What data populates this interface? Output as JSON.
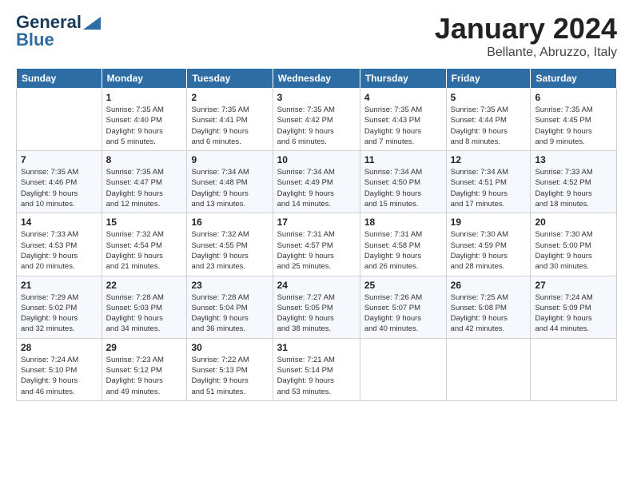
{
  "header": {
    "logo_general": "General",
    "logo_blue": "Blue",
    "month": "January 2024",
    "location": "Bellante, Abruzzo, Italy"
  },
  "weekdays": [
    "Sunday",
    "Monday",
    "Tuesday",
    "Wednesday",
    "Thursday",
    "Friday",
    "Saturday"
  ],
  "weeks": [
    [
      {
        "day": "",
        "info": ""
      },
      {
        "day": "1",
        "info": "Sunrise: 7:35 AM\nSunset: 4:40 PM\nDaylight: 9 hours\nand 5 minutes."
      },
      {
        "day": "2",
        "info": "Sunrise: 7:35 AM\nSunset: 4:41 PM\nDaylight: 9 hours\nand 6 minutes."
      },
      {
        "day": "3",
        "info": "Sunrise: 7:35 AM\nSunset: 4:42 PM\nDaylight: 9 hours\nand 6 minutes."
      },
      {
        "day": "4",
        "info": "Sunrise: 7:35 AM\nSunset: 4:43 PM\nDaylight: 9 hours\nand 7 minutes."
      },
      {
        "day": "5",
        "info": "Sunrise: 7:35 AM\nSunset: 4:44 PM\nDaylight: 9 hours\nand 8 minutes."
      },
      {
        "day": "6",
        "info": "Sunrise: 7:35 AM\nSunset: 4:45 PM\nDaylight: 9 hours\nand 9 minutes."
      }
    ],
    [
      {
        "day": "7",
        "info": "Sunrise: 7:35 AM\nSunset: 4:46 PM\nDaylight: 9 hours\nand 10 minutes."
      },
      {
        "day": "8",
        "info": "Sunrise: 7:35 AM\nSunset: 4:47 PM\nDaylight: 9 hours\nand 12 minutes."
      },
      {
        "day": "9",
        "info": "Sunrise: 7:34 AM\nSunset: 4:48 PM\nDaylight: 9 hours\nand 13 minutes."
      },
      {
        "day": "10",
        "info": "Sunrise: 7:34 AM\nSunset: 4:49 PM\nDaylight: 9 hours\nand 14 minutes."
      },
      {
        "day": "11",
        "info": "Sunrise: 7:34 AM\nSunset: 4:50 PM\nDaylight: 9 hours\nand 15 minutes."
      },
      {
        "day": "12",
        "info": "Sunrise: 7:34 AM\nSunset: 4:51 PM\nDaylight: 9 hours\nand 17 minutes."
      },
      {
        "day": "13",
        "info": "Sunrise: 7:33 AM\nSunset: 4:52 PM\nDaylight: 9 hours\nand 18 minutes."
      }
    ],
    [
      {
        "day": "14",
        "info": "Sunrise: 7:33 AM\nSunset: 4:53 PM\nDaylight: 9 hours\nand 20 minutes."
      },
      {
        "day": "15",
        "info": "Sunrise: 7:32 AM\nSunset: 4:54 PM\nDaylight: 9 hours\nand 21 minutes."
      },
      {
        "day": "16",
        "info": "Sunrise: 7:32 AM\nSunset: 4:55 PM\nDaylight: 9 hours\nand 23 minutes."
      },
      {
        "day": "17",
        "info": "Sunrise: 7:31 AM\nSunset: 4:57 PM\nDaylight: 9 hours\nand 25 minutes."
      },
      {
        "day": "18",
        "info": "Sunrise: 7:31 AM\nSunset: 4:58 PM\nDaylight: 9 hours\nand 26 minutes."
      },
      {
        "day": "19",
        "info": "Sunrise: 7:30 AM\nSunset: 4:59 PM\nDaylight: 9 hours\nand 28 minutes."
      },
      {
        "day": "20",
        "info": "Sunrise: 7:30 AM\nSunset: 5:00 PM\nDaylight: 9 hours\nand 30 minutes."
      }
    ],
    [
      {
        "day": "21",
        "info": "Sunrise: 7:29 AM\nSunset: 5:02 PM\nDaylight: 9 hours\nand 32 minutes."
      },
      {
        "day": "22",
        "info": "Sunrise: 7:28 AM\nSunset: 5:03 PM\nDaylight: 9 hours\nand 34 minutes."
      },
      {
        "day": "23",
        "info": "Sunrise: 7:28 AM\nSunset: 5:04 PM\nDaylight: 9 hours\nand 36 minutes."
      },
      {
        "day": "24",
        "info": "Sunrise: 7:27 AM\nSunset: 5:05 PM\nDaylight: 9 hours\nand 38 minutes."
      },
      {
        "day": "25",
        "info": "Sunrise: 7:26 AM\nSunset: 5:07 PM\nDaylight: 9 hours\nand 40 minutes."
      },
      {
        "day": "26",
        "info": "Sunrise: 7:25 AM\nSunset: 5:08 PM\nDaylight: 9 hours\nand 42 minutes."
      },
      {
        "day": "27",
        "info": "Sunrise: 7:24 AM\nSunset: 5:09 PM\nDaylight: 9 hours\nand 44 minutes."
      }
    ],
    [
      {
        "day": "28",
        "info": "Sunrise: 7:24 AM\nSunset: 5:10 PM\nDaylight: 9 hours\nand 46 minutes."
      },
      {
        "day": "29",
        "info": "Sunrise: 7:23 AM\nSunset: 5:12 PM\nDaylight: 9 hours\nand 49 minutes."
      },
      {
        "day": "30",
        "info": "Sunrise: 7:22 AM\nSunset: 5:13 PM\nDaylight: 9 hours\nand 51 minutes."
      },
      {
        "day": "31",
        "info": "Sunrise: 7:21 AM\nSunset: 5:14 PM\nDaylight: 9 hours\nand 53 minutes."
      },
      {
        "day": "",
        "info": ""
      },
      {
        "day": "",
        "info": ""
      },
      {
        "day": "",
        "info": ""
      }
    ]
  ]
}
